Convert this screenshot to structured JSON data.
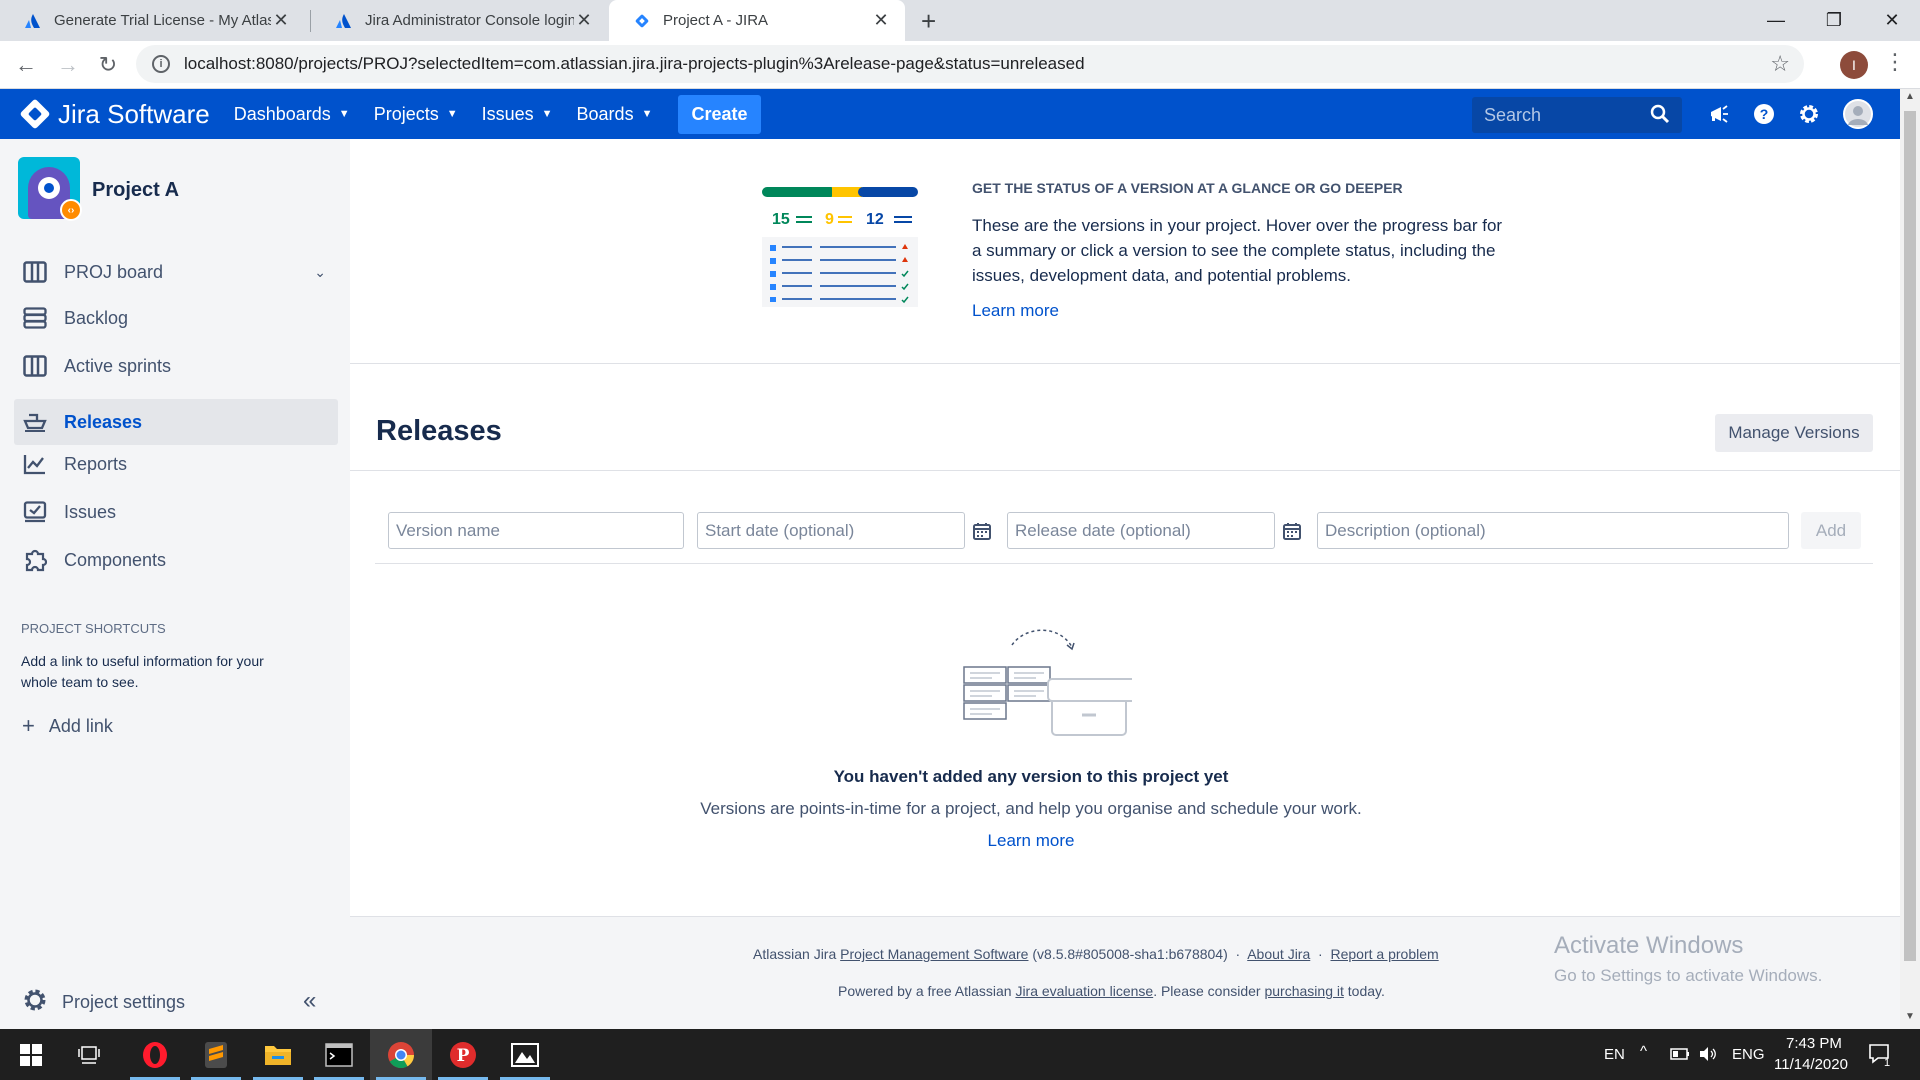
{
  "browser": {
    "tabs": [
      {
        "title": "Generate Trial License - My Atlas"
      },
      {
        "title": "Jira Administrator Console login"
      },
      {
        "title": "Project A - JIRA"
      }
    ],
    "url": "localhost:8080/projects/PROJ?selectedItem=com.atlassian.jira.jira-projects-plugin%3Arelease-page&status=unreleased",
    "profile_initial": "I"
  },
  "header": {
    "brand": "Jira Software",
    "nav": [
      "Dashboards",
      "Projects",
      "Issues",
      "Boards"
    ],
    "create_label": "Create",
    "search_placeholder": "Search"
  },
  "sidebar": {
    "project_name": "Project A",
    "items": [
      {
        "label": "PROJ board"
      },
      {
        "label": "Backlog"
      },
      {
        "label": "Active sprints"
      },
      {
        "label": "Releases"
      },
      {
        "label": "Reports"
      },
      {
        "label": "Issues"
      },
      {
        "label": "Components"
      }
    ],
    "shortcuts_heading": "PROJECT SHORTCUTS",
    "shortcuts_text": "Add a link to useful information for your whole team to see.",
    "add_link": "Add link",
    "settings": "Project settings"
  },
  "promo": {
    "counts": [
      "15",
      "9",
      "12"
    ],
    "title": "GET THE STATUS OF A VERSION AT A GLANCE OR GO DEEPER",
    "text": "These are the versions in your project. Hover over the progress bar for a summary or click a version to see the complete status, including the issues, development data, and potential problems.",
    "learn_more": "Learn more"
  },
  "releases": {
    "title": "Releases",
    "manage_label": "Manage Versions",
    "form": {
      "version_placeholder": "Version name",
      "start_placeholder": "Start date (optional)",
      "release_placeholder": "Release date (optional)",
      "description_placeholder": "Description (optional)",
      "add_label": "Add"
    },
    "empty": {
      "heading": "You haven't added any version to this project yet",
      "text": "Versions are points-in-time for a project, and help you organise and schedule your work.",
      "learn_more": "Learn more"
    }
  },
  "footer": {
    "line1_prefix": "Atlassian Jira",
    "line1_link": "Project Management Software",
    "line1_version": "(v8.5.8#805008-sha1:b678804)",
    "about": "About Jira",
    "report": "Report a problem",
    "line2_prefix": "Powered by a free Atlassian",
    "line2_link": "Jira evaluation license",
    "line2_mid": ". Please consider",
    "line2_link2": "purchasing it",
    "line2_suffix": "today."
  },
  "watermark": {
    "line1": "Activate Windows",
    "line2": "Go to Settings to activate Windows."
  },
  "taskbar": {
    "lang": "EN",
    "input": "ENG",
    "time": "7:43 PM",
    "date": "11/14/2020",
    "notif_count": "1"
  },
  "colors": {
    "jira_blue": "#0052cc",
    "create_blue": "#2684ff",
    "progress_green": "#00875a",
    "progress_yellow": "#ffc400",
    "progress_navy": "#0747a6"
  }
}
